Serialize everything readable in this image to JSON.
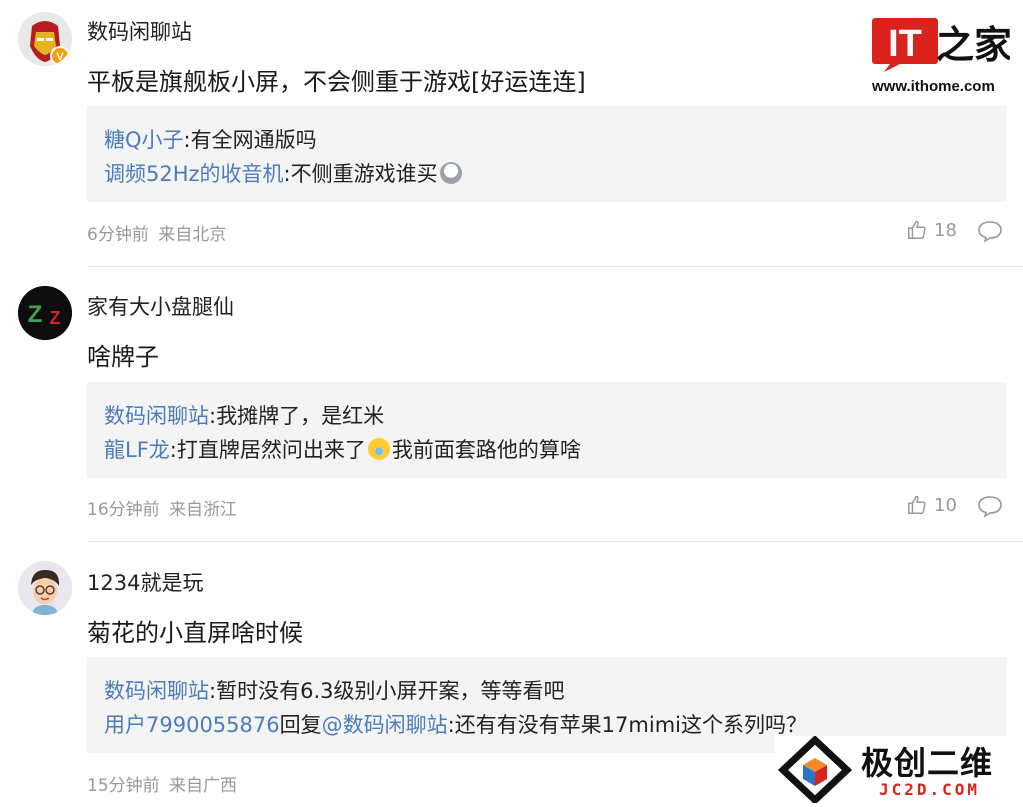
{
  "brand": {
    "logo_text": "IT之家",
    "url": "www.ithome.com"
  },
  "watermark": {
    "name": "极创二维",
    "domain": "JC2D.COM"
  },
  "actions": {
    "like_icon": "thumbs-up-icon",
    "reply_icon": "speech-bubble-icon"
  },
  "comments": [
    {
      "username": "数码闲聊站",
      "content": "平板是旗舰板小屏，不会侧重于游戏[好运连连]",
      "replies": [
        {
          "name": "糖Q小子",
          "sep": ":",
          "text": "有全网通版吗"
        },
        {
          "name": "调频52Hz的收音机",
          "sep": ":",
          "text": "不侧重游戏谁买"
        }
      ],
      "time": "6分钟前",
      "location": "来自北京",
      "likes": "18"
    },
    {
      "username": "家有大小盘腿仙",
      "content": "啥牌子",
      "replies": [
        {
          "name": "数码闲聊站",
          "sep": ":",
          "text": "我摊牌了，是红米"
        },
        {
          "name": "龍LF龙",
          "sep": ":",
          "text": "打直牌居然问出来了",
          "text2": "我前面套路他的算啥"
        }
      ],
      "time": "16分钟前",
      "location": "来自浙江",
      "likes": "10"
    },
    {
      "username": "1234就是玩",
      "content": "菊花的小直屏啥时候",
      "replies": [
        {
          "name": "数码闲聊站",
          "sep": ":",
          "text": "暂时没有6.3级别小屏开案，等等看吧"
        },
        {
          "name": "用户7990055876",
          "mid": "回复",
          "target": "@数码闲聊站",
          "sep": ":",
          "text": "还有有没有苹果17mimi这个系列吗？"
        }
      ],
      "time": "15分钟前",
      "location": "来自广西"
    }
  ]
}
